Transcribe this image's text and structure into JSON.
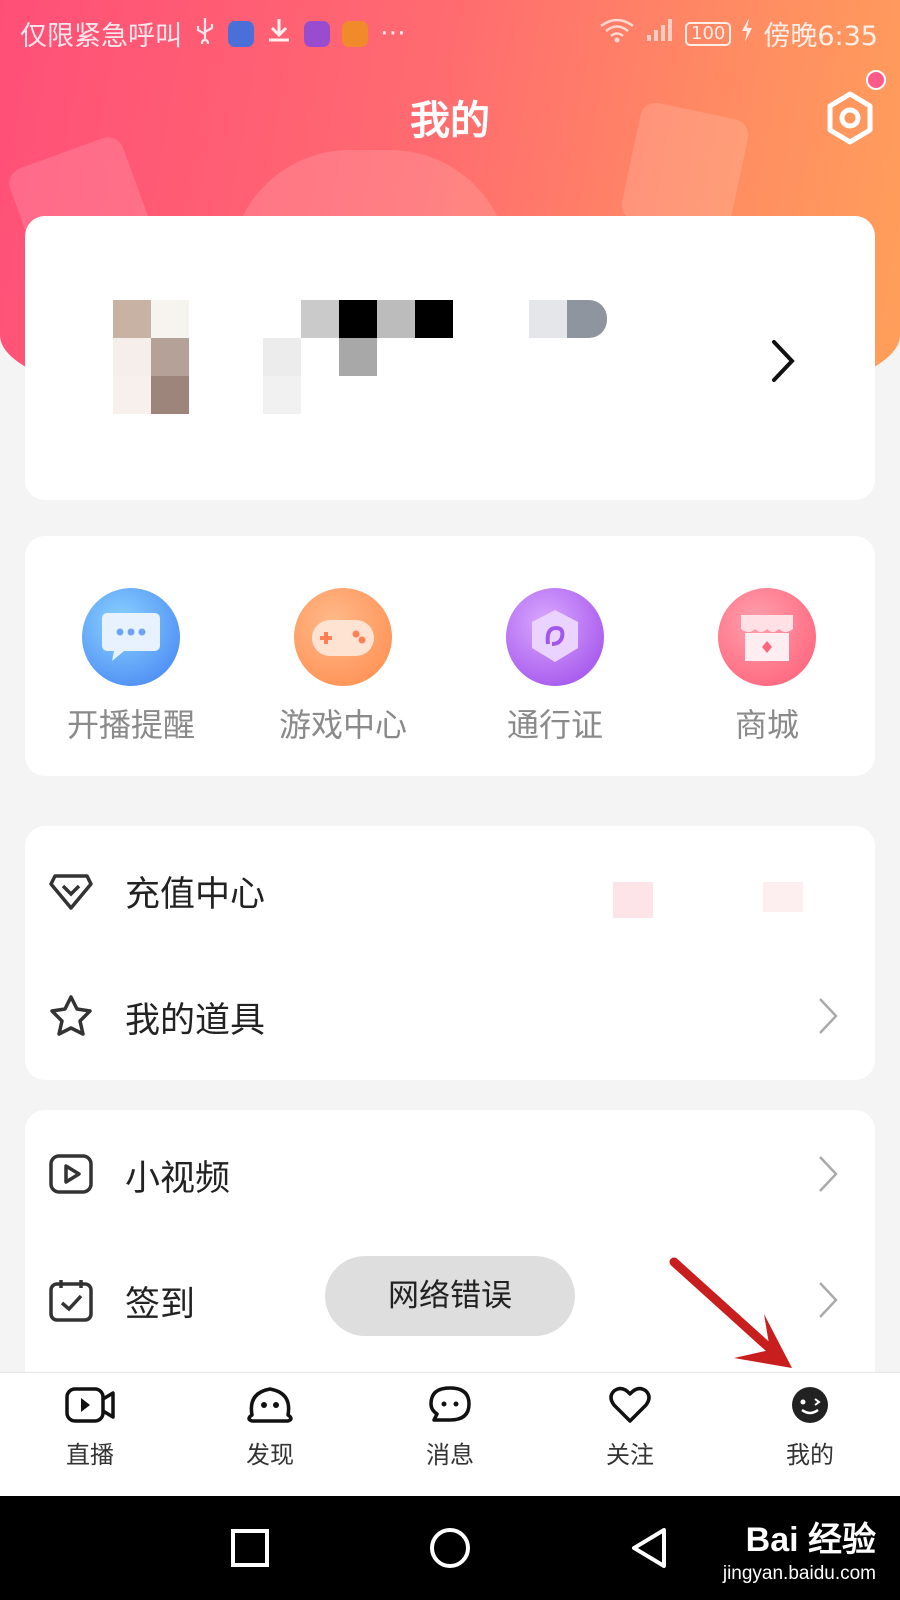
{
  "status_bar": {
    "left_text": "仅限紧急呼叫",
    "more": "···",
    "battery": "100",
    "time": "傍晚6:35"
  },
  "header": {
    "title": "我的"
  },
  "quick_actions": [
    {
      "label": "开播提醒",
      "icon": "chat-bubble-icon"
    },
    {
      "label": "游戏中心",
      "icon": "gamepad-icon"
    },
    {
      "label": "通行证",
      "icon": "pass-shield-icon"
    },
    {
      "label": "商城",
      "icon": "store-icon"
    }
  ],
  "menu_group_1": [
    {
      "label": "充值中心",
      "icon": "diamond-icon"
    },
    {
      "label": "我的道具",
      "icon": "star-icon"
    }
  ],
  "menu_group_2": [
    {
      "label": "小视频",
      "icon": "video-icon"
    },
    {
      "label": "签到",
      "icon": "calendar-check-icon"
    }
  ],
  "toast": "网络错误",
  "bottom_nav": [
    {
      "label": "直播",
      "icon": "live-camera-icon"
    },
    {
      "label": "发现",
      "icon": "discover-face-icon"
    },
    {
      "label": "消息",
      "icon": "message-icon"
    },
    {
      "label": "关注",
      "icon": "heart-icon"
    },
    {
      "label": "我的",
      "icon": "me-face-icon",
      "active": true
    }
  ],
  "watermark": {
    "brand": "Bai 经验",
    "url": "jingyan.baidu.com"
  },
  "colors": {
    "header_start": "#ff4f78",
    "header_end": "#ffa05a",
    "annotation_arrow": "#c81e1e"
  }
}
